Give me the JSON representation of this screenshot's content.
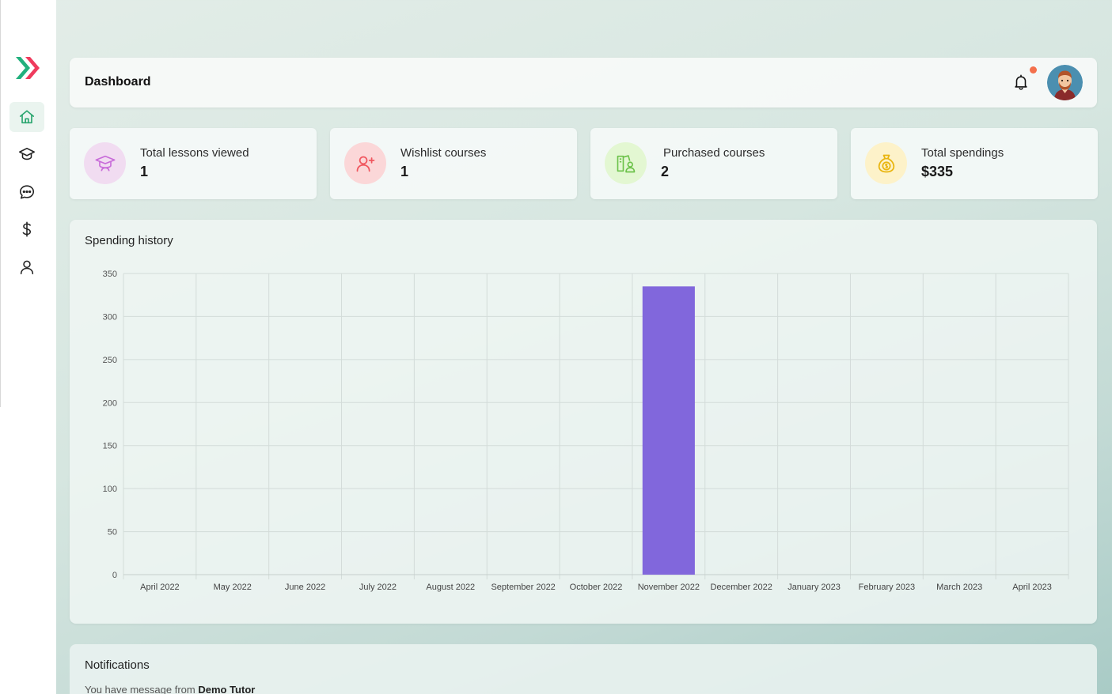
{
  "header": {
    "title": "Dashboard"
  },
  "sidebar": {
    "items": [
      {
        "name": "home",
        "icon": "home-icon",
        "active": true
      },
      {
        "name": "courses",
        "icon": "graduation-cap-icon",
        "active": false
      },
      {
        "name": "messages",
        "icon": "chat-icon",
        "active": false
      },
      {
        "name": "payments",
        "icon": "dollar-icon",
        "active": false
      },
      {
        "name": "profile",
        "icon": "user-icon",
        "active": false
      }
    ]
  },
  "stats": [
    {
      "label": "Total lessons viewed",
      "value": "1",
      "icon": "graduation-cap-icon",
      "color": "#c86bd9",
      "bg": "#f1dcf1"
    },
    {
      "label": "Wishlist courses",
      "value": "1",
      "icon": "user-plus-icon",
      "color": "#f0575f",
      "bg": "#fbd7d8"
    },
    {
      "label": "Purchased courses",
      "value": "2",
      "icon": "book-user-icon",
      "color": "#6cc24a",
      "bg": "#e3f7d2"
    },
    {
      "label": "Total spendings",
      "value": "$335",
      "icon": "money-bag-icon",
      "color": "#e9b50f",
      "bg": "#fdf2c9"
    }
  ],
  "spending": {
    "title": "Spending history"
  },
  "chart_data": {
    "type": "bar",
    "categories": [
      "April 2022",
      "May 2022",
      "June 2022",
      "July 2022",
      "August 2022",
      "September 2022",
      "October 2022",
      "November 2022",
      "December 2022",
      "January 2023",
      "February 2023",
      "March 2023",
      "April 2023"
    ],
    "values": [
      0,
      0,
      0,
      0,
      0,
      0,
      0,
      335,
      0,
      0,
      0,
      0,
      0
    ],
    "yticks": [
      0,
      50,
      100,
      150,
      200,
      250,
      300,
      350
    ],
    "ylim": [
      0,
      350
    ],
    "bar_color": "#8167dc",
    "grid": true
  },
  "notifications": {
    "title": "Notifications",
    "message_prefix": "You have message from",
    "message_sender": "Demo Tutor"
  },
  "colors": {
    "accent": "#2bb673",
    "notification_dot": "#f4704c"
  }
}
